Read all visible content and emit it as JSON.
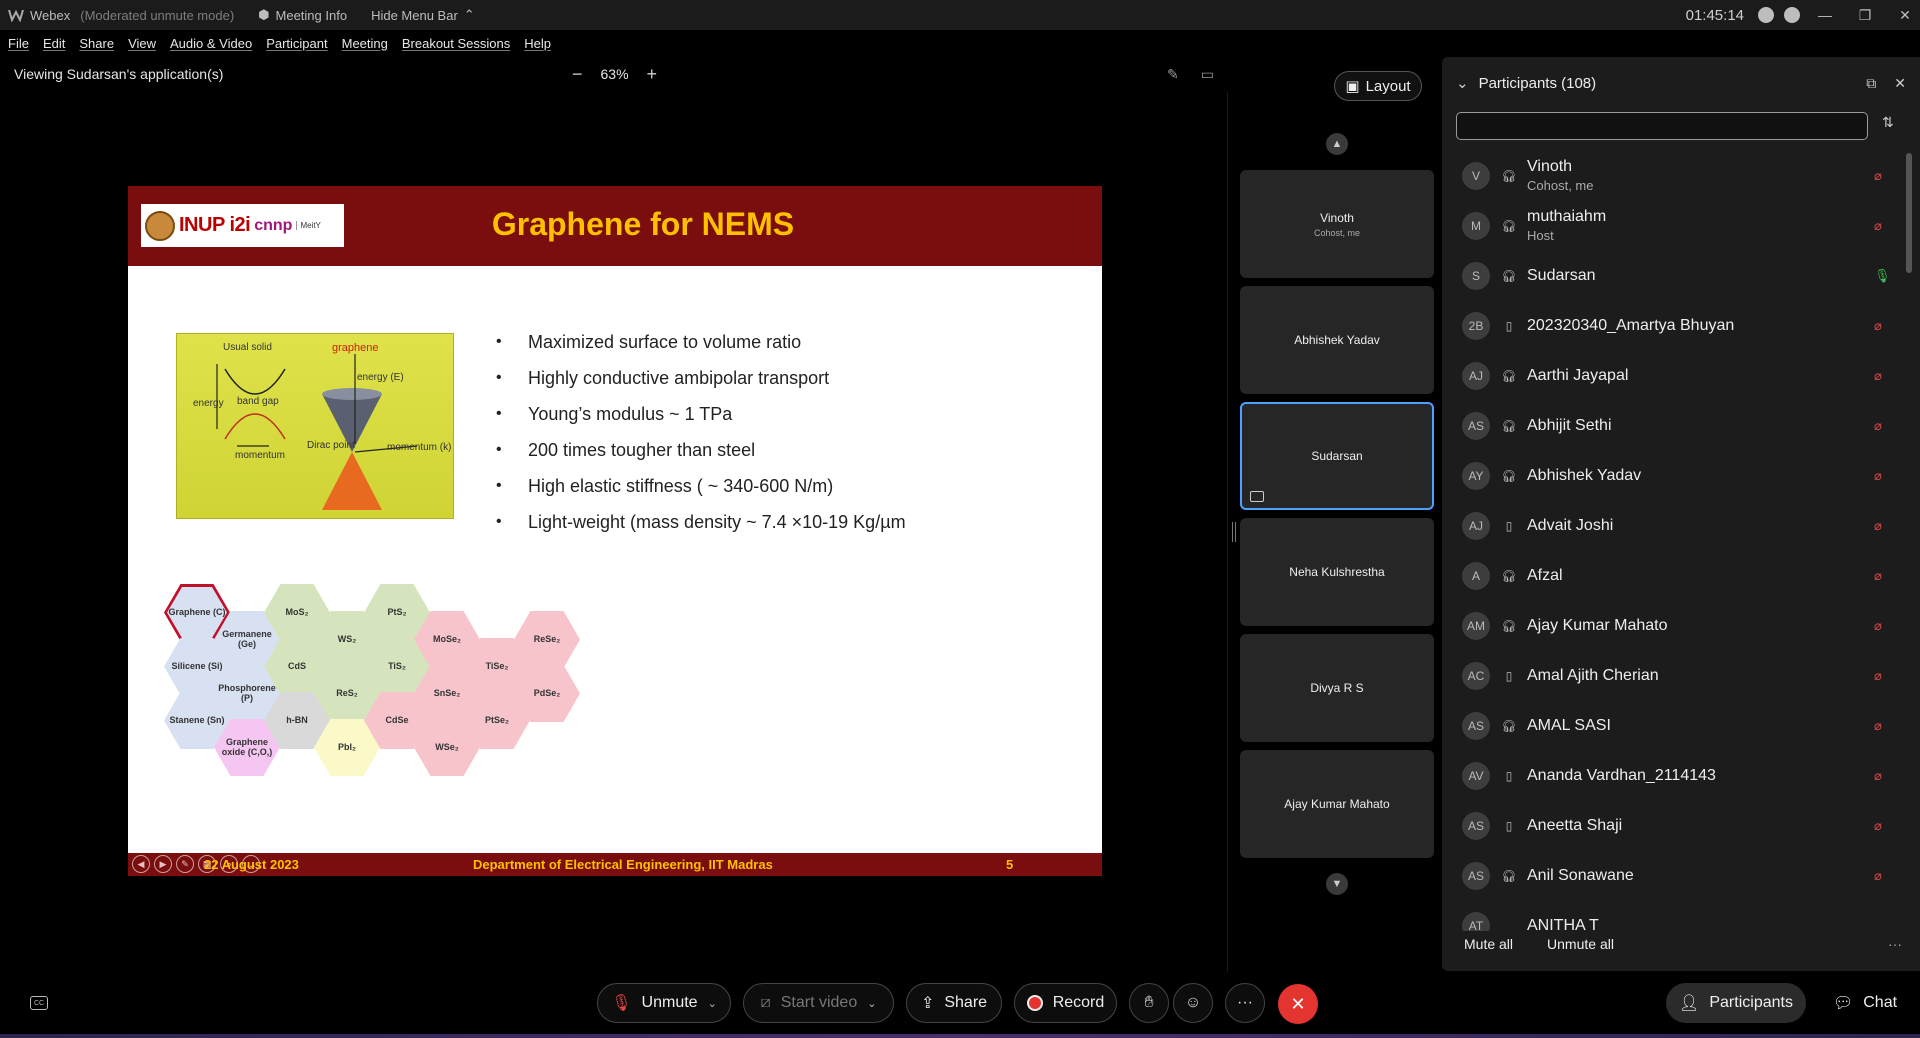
{
  "titlebar": {
    "app_name": "Webex",
    "mode": "(Moderated unmute mode)",
    "meeting_info": "Meeting Info",
    "hide_menu": "Hide Menu Bar",
    "clock": "01:45:14"
  },
  "menu": [
    "File",
    "Edit",
    "Share",
    "View",
    "Audio & Video",
    "Participant",
    "Meeting",
    "Breakout Sessions",
    "Help"
  ],
  "sharebar": {
    "viewing": "Viewing Sudarsan's application(s)",
    "zoom": "63%"
  },
  "slide": {
    "logo_text": "INUP i2i",
    "logo_text2": "cnnp",
    "logo_small": "MeitY",
    "title": "Graphene for NEMS",
    "figure_labels": {
      "usual_solid": "Usual solid",
      "graphene": "graphene",
      "energy": "energy",
      "band_gap": "band gap",
      "momentum": "momentum",
      "energy_e": "energy (E)",
      "dirac_point": "Dirac point",
      "momentum_k": "momentum (k)"
    },
    "bullets": [
      "Maximized surface to volume ratio",
      "Highly conductive ambipolar transport",
      "Young’s modulus ~ 1 TPa",
      "200 times tougher than steel",
      "High elastic stiffness ( ~ 340-600 N/m)",
      "Light-weight (mass density ~ 7.4 ×10-19 Kg/µm"
    ],
    "hexes": [
      {
        "label": "Graphene (C)",
        "color": "red"
      },
      {
        "label": "Germanene (Ge)",
        "color": "blue"
      },
      {
        "label": "Silicene (Si)",
        "color": "blue"
      },
      {
        "label": "Phosphorene (P)",
        "color": "blue"
      },
      {
        "label": "Stanene (Sn)",
        "color": "blue"
      },
      {
        "label": "Graphene oxide (C,O,)",
        "color": "violet"
      },
      {
        "label": "MoS₂",
        "color": "green"
      },
      {
        "label": "CdS",
        "color": "green"
      },
      {
        "label": "h-BN",
        "color": "grey"
      },
      {
        "label": "WS₂",
        "color": "green"
      },
      {
        "label": "ReS₂",
        "color": "green"
      },
      {
        "label": "PbI₂",
        "color": "yellow"
      },
      {
        "label": "PtS₂",
        "color": "green"
      },
      {
        "label": "TiS₂",
        "color": "green"
      },
      {
        "label": "CdSe",
        "color": "pink"
      },
      {
        "label": "MoSe₂",
        "color": "pink"
      },
      {
        "label": "SnSe₂",
        "color": "pink"
      },
      {
        "label": "WSe₂",
        "color": "pink"
      },
      {
        "label": "TiSe₂",
        "color": "pink"
      },
      {
        "label": "PtSe₂",
        "color": "pink"
      },
      {
        "label": "ReSe₂",
        "color": "pink"
      },
      {
        "label": "PdSe₂",
        "color": "pink"
      }
    ],
    "footer_date": "22 August 2023",
    "footer_dept": "Department of Electrical Engineering, IIT Madras",
    "footer_page": "5"
  },
  "video_strip": {
    "layout_label": "Layout",
    "tiles": [
      {
        "name": "Vinoth",
        "sub": "Cohost, me",
        "active": false
      },
      {
        "name": "Abhishek Yadav",
        "sub": "",
        "active": false
      },
      {
        "name": "Sudarsan",
        "sub": "",
        "active": true
      },
      {
        "name": "Neha Kulshrestha",
        "sub": "",
        "active": false
      },
      {
        "name": "Divya R S",
        "sub": "",
        "active": false
      },
      {
        "name": "Ajay Kumar Mahato",
        "sub": "",
        "active": false
      }
    ]
  },
  "participants": {
    "title": "Participants (108)",
    "search_placeholder": "",
    "list": [
      {
        "initials": "V",
        "name": "Vinoth",
        "role": "Cohost, me",
        "device": "headset",
        "mic": "muted"
      },
      {
        "initials": "M",
        "name": "muthaiahm",
        "role": "Host",
        "device": "headset",
        "mic": "muted"
      },
      {
        "initials": "S",
        "name": "Sudarsan",
        "role": "",
        "device": "headset",
        "mic": "on"
      },
      {
        "initials": "2B",
        "name": "202320340_Amartya Bhuyan",
        "role": "",
        "device": "phone",
        "mic": "muted"
      },
      {
        "initials": "AJ",
        "name": "Aarthi Jayapal",
        "role": "",
        "device": "headset",
        "mic": "muted"
      },
      {
        "initials": "AS",
        "name": "Abhijit Sethi",
        "role": "",
        "device": "headset",
        "mic": "muted"
      },
      {
        "initials": "AY",
        "name": "Abhishek Yadav",
        "role": "",
        "device": "headset",
        "mic": "muted"
      },
      {
        "initials": "AJ",
        "name": "Advait Joshi",
        "role": "",
        "device": "phone",
        "mic": "muted"
      },
      {
        "initials": "A",
        "name": "Afzal",
        "role": "",
        "device": "headset",
        "mic": "muted"
      },
      {
        "initials": "AM",
        "name": "Ajay Kumar Mahato",
        "role": "",
        "device": "headset",
        "mic": "muted"
      },
      {
        "initials": "AC",
        "name": "Amal Ajith Cherian",
        "role": "",
        "device": "phone",
        "mic": "muted"
      },
      {
        "initials": "AS",
        "name": "AMAL SASI",
        "role": "",
        "device": "headset",
        "mic": "muted"
      },
      {
        "initials": "AV",
        "name": "Ananda Vardhan_2114143",
        "role": "",
        "device": "phone",
        "mic": "muted"
      },
      {
        "initials": "AS",
        "name": "Aneetta Shaji",
        "role": "",
        "device": "phone",
        "mic": "muted"
      },
      {
        "initials": "AS",
        "name": "Anil Sonawane",
        "role": "",
        "device": "headset",
        "mic": "muted"
      },
      {
        "initials": "AT",
        "name": "ANITHA T",
        "role": "",
        "device": "",
        "mic": ""
      }
    ],
    "mute_all": "Mute all",
    "unmute_all": "Unmute all"
  },
  "controls": {
    "unmute": "Unmute",
    "start_video": "Start video",
    "share": "Share",
    "record": "Record",
    "participants": "Participants",
    "chat": "Chat"
  }
}
